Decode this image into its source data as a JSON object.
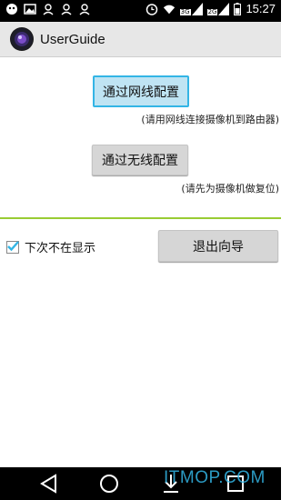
{
  "status_bar": {
    "time": "15:27",
    "network_badge_1": "3G",
    "network_badge_2": "2G",
    "icons": [
      "chat-icon",
      "image-icon",
      "person-icon",
      "person-icon",
      "person-icon",
      "alarm-icon",
      "wifi-icon",
      "signal-icon",
      "signal-icon",
      "battery-icon"
    ]
  },
  "action_bar": {
    "title": "UserGuide",
    "icon": "camera-lens-icon"
  },
  "wired": {
    "button_label": "通过网线配置",
    "hint": "(请用网线连接摄像机到路由器)"
  },
  "wireless": {
    "button_label": "通过无线配置",
    "hint": "(请先为摄像机做复位)"
  },
  "footer": {
    "checkbox_label": "下次不在显示",
    "checkbox_checked": true,
    "exit_label": "退出向导"
  },
  "colors": {
    "accent": "#33b5e5",
    "divider": "#99cc33",
    "actionbar": "#e7e7e7"
  },
  "navigation": {
    "icons": [
      "back-icon",
      "home-icon",
      "download-icon",
      "recents-icon"
    ]
  },
  "watermark": "ITMOP.COM"
}
